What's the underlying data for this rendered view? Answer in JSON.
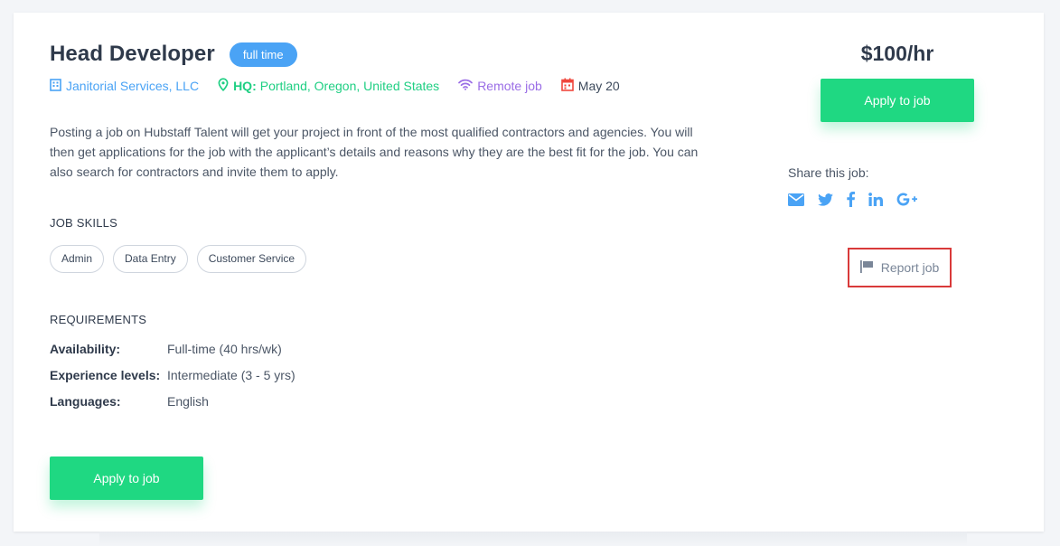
{
  "job": {
    "title": "Head Developer",
    "type_badge": "full time",
    "company": "Janitorial Services, LLC",
    "hq_label": "HQ:",
    "hq_location": "Portland, Oregon, United States",
    "remote": "Remote job",
    "date": "May 20",
    "description": "Posting a job on Hubstaff Talent will get your project in front of the most qualified contractors and agencies. You will then get applications for the job with the applicant’s details and reasons why they are the best fit for the job. You can also search for contractors and invite them to apply.",
    "rate": "$100/hr"
  },
  "skills": {
    "heading": "JOB SKILLS",
    "items": [
      "Admin",
      "Data Entry",
      "Customer Service"
    ]
  },
  "requirements": {
    "heading": "REQUIREMENTS",
    "rows": [
      {
        "label": "Availability:",
        "value": "Full-time (40 hrs/wk)"
      },
      {
        "label": "Experience levels:",
        "value": "Intermediate (3 - 5 yrs)"
      },
      {
        "label": "Languages:",
        "value": "English"
      }
    ]
  },
  "actions": {
    "apply_label": "Apply to job",
    "share_label": "Share this job:",
    "share_icons": [
      "email-icon",
      "twitter-icon",
      "facebook-icon",
      "linkedin-icon",
      "google-plus-icon"
    ],
    "report_label": "Report job"
  },
  "colors": {
    "accent_blue": "#4aa3f5",
    "accent_green": "#1fd882",
    "remote_purple": "#9a6de6",
    "date_red": "#f0473d",
    "report_border": "#d93a3a"
  }
}
